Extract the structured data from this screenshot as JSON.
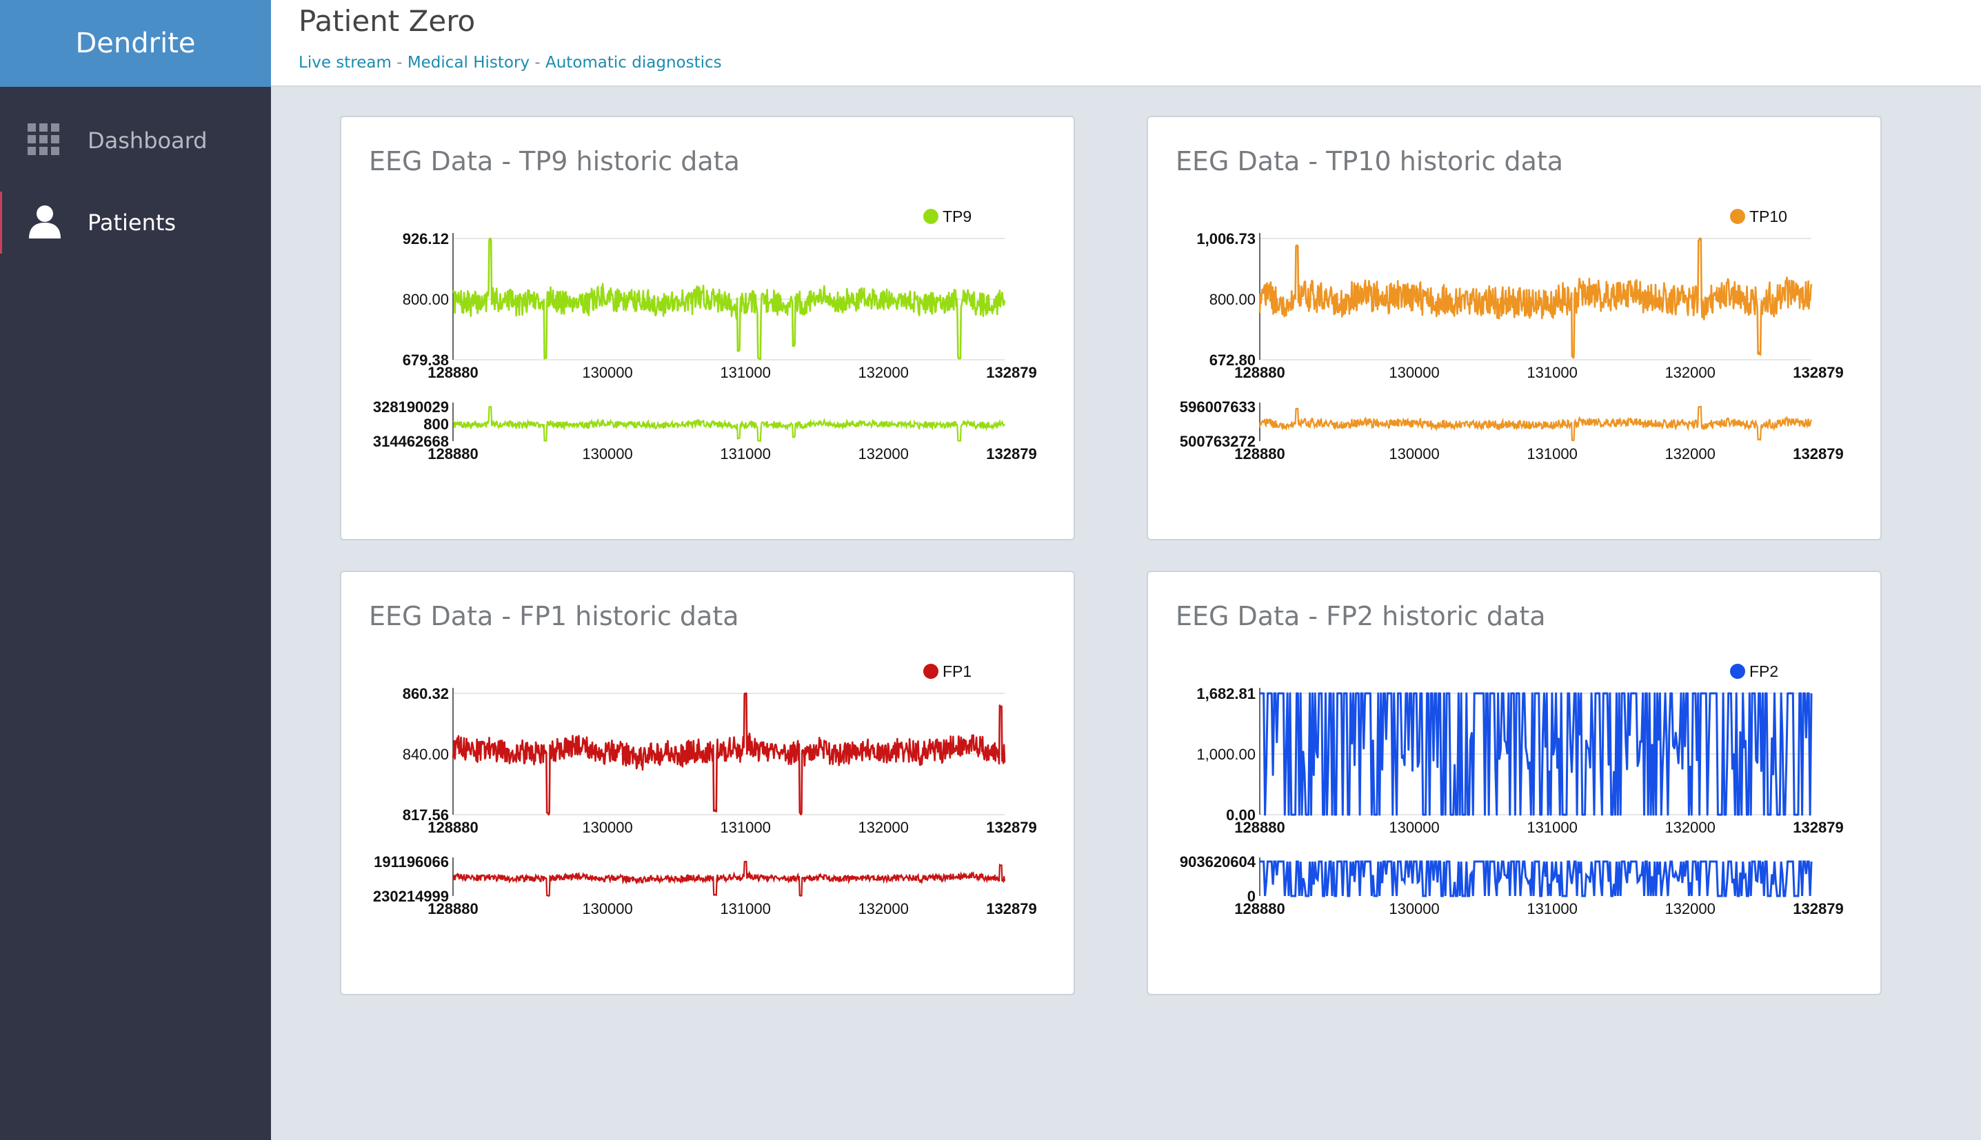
{
  "app": {
    "brand": "Dendrite"
  },
  "sidebar": {
    "items": [
      {
        "label": "Dashboard",
        "icon": "grid-icon"
      },
      {
        "label": "Patients",
        "icon": "user-icon"
      }
    ]
  },
  "header": {
    "title": "Patient Zero",
    "breadcrumb": [
      "Live stream",
      "Medical History",
      "Automatic diagnostics"
    ],
    "separator": " - "
  },
  "chart_data": [
    {
      "type": "line",
      "title": "EEG Data - TP9 historic data",
      "series": [
        {
          "name": "TP9",
          "color": "#97dc12"
        }
      ],
      "x_range": [
        128880,
        132879
      ],
      "x_ticks": [
        "128880",
        "130000",
        "131000",
        "132000",
        "132879"
      ],
      "y_ticks": [
        "926.12",
        "800.00",
        "679.38"
      ],
      "y_range": [
        679.38,
        926.12
      ],
      "baseline": 800,
      "noise_amp": 24,
      "spikes": [
        [
          129150,
          925
        ],
        [
          129550,
          683
        ],
        [
          130950,
          700
        ],
        [
          131100,
          682
        ],
        [
          131350,
          710
        ],
        [
          132550,
          683
        ]
      ],
      "navigator": {
        "y_ticks": [
          "328190029",
          "800",
          "314462668"
        ]
      },
      "legend_position": "top-right"
    },
    {
      "type": "line",
      "title": "EEG Data - TP10 historic data",
      "series": [
        {
          "name": "TP10",
          "color": "#ee9422"
        }
      ],
      "x_range": [
        128880,
        132879
      ],
      "x_ticks": [
        "128880",
        "130000",
        "131000",
        "132000",
        "132879"
      ],
      "y_ticks": [
        "1,006.73",
        "800.00",
        "672.80"
      ],
      "y_range": [
        672.8,
        1006.73
      ],
      "baseline": 840,
      "noise_amp": 42,
      "spikes": [
        [
          129150,
          985
        ],
        [
          132070,
          1005
        ],
        [
          131150,
          680
        ],
        [
          132500,
          690
        ]
      ],
      "navigator": {
        "y_ticks": [
          "596007633",
          "500763272"
        ]
      },
      "legend_position": "top-right"
    },
    {
      "type": "line",
      "title": "EEG Data - FP1 historic data",
      "series": [
        {
          "name": "FP1",
          "color": "#c81414"
        }
      ],
      "x_range": [
        128880,
        132879
      ],
      "x_ticks": [
        "128880",
        "130000",
        "131000",
        "132000",
        "132879"
      ],
      "y_ticks": [
        "860.32",
        "840.00",
        "817.56"
      ],
      "y_range": [
        817.56,
        860.32
      ],
      "baseline": 840,
      "noise_amp": 4,
      "spikes": [
        [
          131000,
          860
        ],
        [
          129570,
          818
        ],
        [
          130780,
          819
        ],
        [
          131400,
          818
        ],
        [
          132850,
          856
        ]
      ],
      "navigator": {
        "y_ticks": [
          "191196066",
          "230214999"
        ]
      },
      "legend_position": "top-right"
    },
    {
      "type": "line",
      "title": "EEG Data - FP2 historic data",
      "series": [
        {
          "name": "FP2",
          "color": "#1650e8"
        }
      ],
      "x_range": [
        128880,
        132879
      ],
      "x_ticks": [
        "128880",
        "130000",
        "131000",
        "132000",
        "132879"
      ],
      "y_ticks": [
        "1,682.81",
        "1,000.00",
        "0.00"
      ],
      "y_range": [
        0,
        1682.81
      ],
      "baseline": 850,
      "noise_amp": 300,
      "spikes": [],
      "square": true,
      "navigator": {
        "y_ticks": [
          "903620604",
          "0"
        ]
      },
      "legend_position": "top-right"
    }
  ]
}
